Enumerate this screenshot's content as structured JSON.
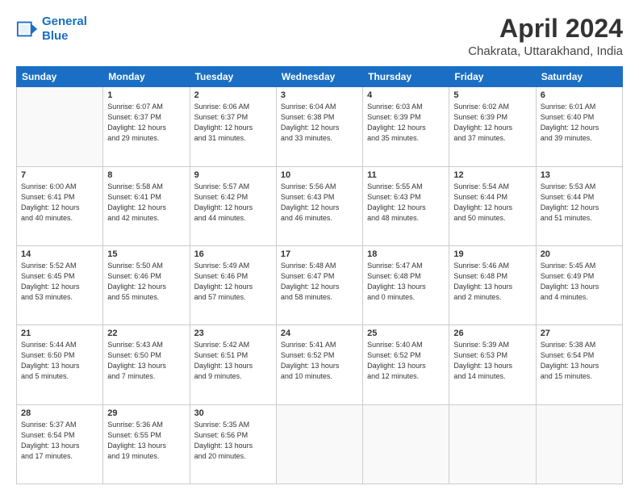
{
  "header": {
    "logo_line1": "General",
    "logo_line2": "Blue",
    "month": "April 2024",
    "location": "Chakrata, Uttarakhand, India"
  },
  "days_of_week": [
    "Sunday",
    "Monday",
    "Tuesday",
    "Wednesday",
    "Thursday",
    "Friday",
    "Saturday"
  ],
  "weeks": [
    [
      {
        "day": "",
        "info": ""
      },
      {
        "day": "1",
        "info": "Sunrise: 6:07 AM\nSunset: 6:37 PM\nDaylight: 12 hours\nand 29 minutes."
      },
      {
        "day": "2",
        "info": "Sunrise: 6:06 AM\nSunset: 6:37 PM\nDaylight: 12 hours\nand 31 minutes."
      },
      {
        "day": "3",
        "info": "Sunrise: 6:04 AM\nSunset: 6:38 PM\nDaylight: 12 hours\nand 33 minutes."
      },
      {
        "day": "4",
        "info": "Sunrise: 6:03 AM\nSunset: 6:39 PM\nDaylight: 12 hours\nand 35 minutes."
      },
      {
        "day": "5",
        "info": "Sunrise: 6:02 AM\nSunset: 6:39 PM\nDaylight: 12 hours\nand 37 minutes."
      },
      {
        "day": "6",
        "info": "Sunrise: 6:01 AM\nSunset: 6:40 PM\nDaylight: 12 hours\nand 39 minutes."
      }
    ],
    [
      {
        "day": "7",
        "info": "Sunrise: 6:00 AM\nSunset: 6:41 PM\nDaylight: 12 hours\nand 40 minutes."
      },
      {
        "day": "8",
        "info": "Sunrise: 5:58 AM\nSunset: 6:41 PM\nDaylight: 12 hours\nand 42 minutes."
      },
      {
        "day": "9",
        "info": "Sunrise: 5:57 AM\nSunset: 6:42 PM\nDaylight: 12 hours\nand 44 minutes."
      },
      {
        "day": "10",
        "info": "Sunrise: 5:56 AM\nSunset: 6:43 PM\nDaylight: 12 hours\nand 46 minutes."
      },
      {
        "day": "11",
        "info": "Sunrise: 5:55 AM\nSunset: 6:43 PM\nDaylight: 12 hours\nand 48 minutes."
      },
      {
        "day": "12",
        "info": "Sunrise: 5:54 AM\nSunset: 6:44 PM\nDaylight: 12 hours\nand 50 minutes."
      },
      {
        "day": "13",
        "info": "Sunrise: 5:53 AM\nSunset: 6:44 PM\nDaylight: 12 hours\nand 51 minutes."
      }
    ],
    [
      {
        "day": "14",
        "info": "Sunrise: 5:52 AM\nSunset: 6:45 PM\nDaylight: 12 hours\nand 53 minutes."
      },
      {
        "day": "15",
        "info": "Sunrise: 5:50 AM\nSunset: 6:46 PM\nDaylight: 12 hours\nand 55 minutes."
      },
      {
        "day": "16",
        "info": "Sunrise: 5:49 AM\nSunset: 6:46 PM\nDaylight: 12 hours\nand 57 minutes."
      },
      {
        "day": "17",
        "info": "Sunrise: 5:48 AM\nSunset: 6:47 PM\nDaylight: 12 hours\nand 58 minutes."
      },
      {
        "day": "18",
        "info": "Sunrise: 5:47 AM\nSunset: 6:48 PM\nDaylight: 13 hours\nand 0 minutes."
      },
      {
        "day": "19",
        "info": "Sunrise: 5:46 AM\nSunset: 6:48 PM\nDaylight: 13 hours\nand 2 minutes."
      },
      {
        "day": "20",
        "info": "Sunrise: 5:45 AM\nSunset: 6:49 PM\nDaylight: 13 hours\nand 4 minutes."
      }
    ],
    [
      {
        "day": "21",
        "info": "Sunrise: 5:44 AM\nSunset: 6:50 PM\nDaylight: 13 hours\nand 5 minutes."
      },
      {
        "day": "22",
        "info": "Sunrise: 5:43 AM\nSunset: 6:50 PM\nDaylight: 13 hours\nand 7 minutes."
      },
      {
        "day": "23",
        "info": "Sunrise: 5:42 AM\nSunset: 6:51 PM\nDaylight: 13 hours\nand 9 minutes."
      },
      {
        "day": "24",
        "info": "Sunrise: 5:41 AM\nSunset: 6:52 PM\nDaylight: 13 hours\nand 10 minutes."
      },
      {
        "day": "25",
        "info": "Sunrise: 5:40 AM\nSunset: 6:52 PM\nDaylight: 13 hours\nand 12 minutes."
      },
      {
        "day": "26",
        "info": "Sunrise: 5:39 AM\nSunset: 6:53 PM\nDaylight: 13 hours\nand 14 minutes."
      },
      {
        "day": "27",
        "info": "Sunrise: 5:38 AM\nSunset: 6:54 PM\nDaylight: 13 hours\nand 15 minutes."
      }
    ],
    [
      {
        "day": "28",
        "info": "Sunrise: 5:37 AM\nSunset: 6:54 PM\nDaylight: 13 hours\nand 17 minutes."
      },
      {
        "day": "29",
        "info": "Sunrise: 5:36 AM\nSunset: 6:55 PM\nDaylight: 13 hours\nand 19 minutes."
      },
      {
        "day": "30",
        "info": "Sunrise: 5:35 AM\nSunset: 6:56 PM\nDaylight: 13 hours\nand 20 minutes."
      },
      {
        "day": "",
        "info": ""
      },
      {
        "day": "",
        "info": ""
      },
      {
        "day": "",
        "info": ""
      },
      {
        "day": "",
        "info": ""
      }
    ]
  ]
}
